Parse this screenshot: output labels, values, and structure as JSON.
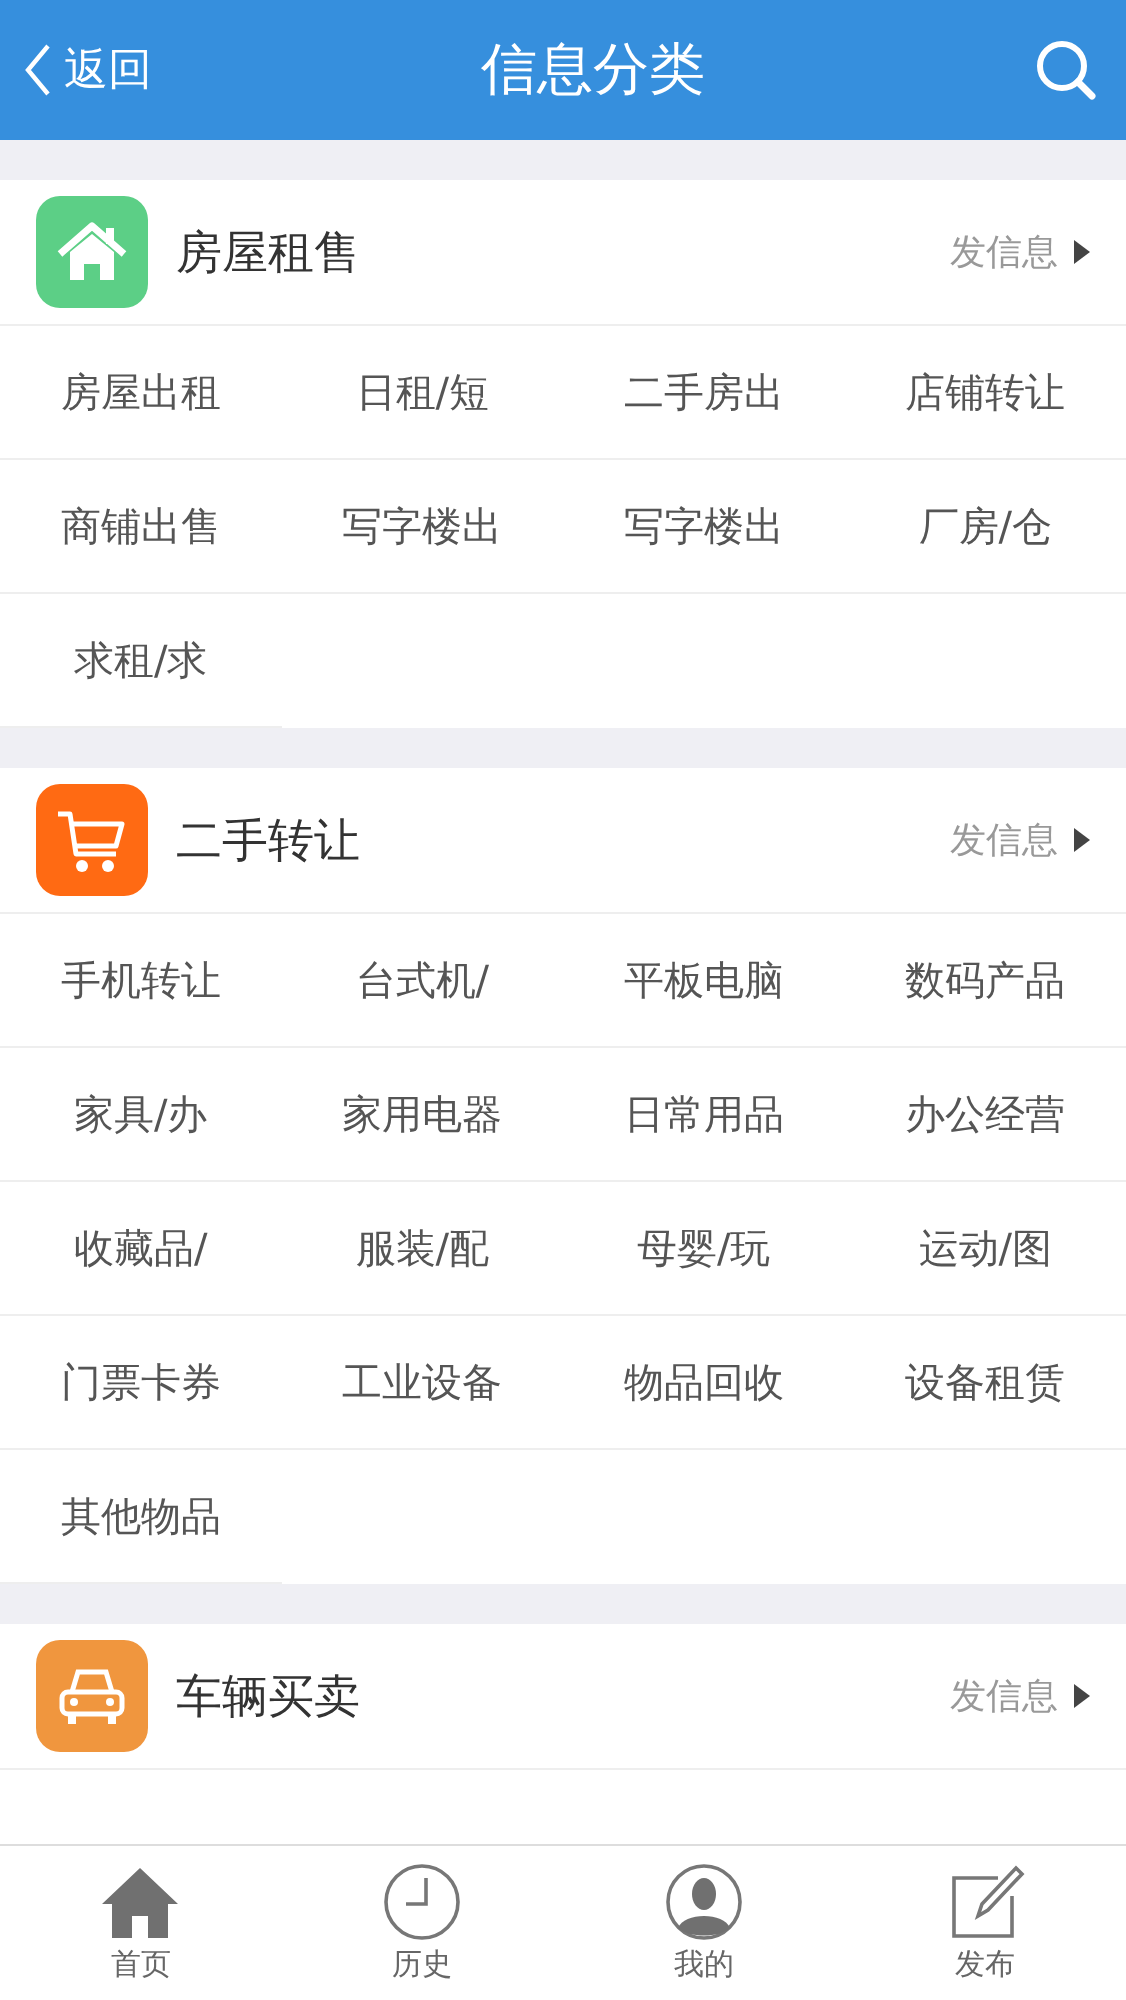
{
  "header": {
    "back": "返回",
    "title": "信息分类"
  },
  "sections": [
    {
      "title": "房屋租售",
      "kind": "house",
      "color": "#5ccf86",
      "action": "发信息",
      "items": [
        "房屋出租",
        "日租/短",
        "二手房出",
        "店铺转让",
        "商铺出售",
        "写字楼出",
        "写字楼出",
        "厂房/仓",
        "求租/求"
      ]
    },
    {
      "title": "二手转让",
      "kind": "cart",
      "color": "#ff6a13",
      "action": "发信息",
      "items": [
        "手机转让",
        "台式机/",
        "平板电脑",
        "数码产品",
        "家具/办",
        "家用电器",
        "日常用品",
        "办公经营",
        "收藏品/",
        "服装/配",
        "母婴/玩",
        "运动/图",
        "门票卡券",
        "工业设备",
        "物品回收",
        "设备租赁",
        "其他物品"
      ]
    },
    {
      "title": "车辆买卖",
      "kind": "car",
      "color": "#f0963e",
      "action": "发信息"
    }
  ],
  "tabbar": [
    {
      "label": "首页",
      "kind": "home"
    },
    {
      "label": "历史",
      "kind": "clock"
    },
    {
      "label": "我的",
      "kind": "person"
    },
    {
      "label": "发布",
      "kind": "edit"
    }
  ]
}
